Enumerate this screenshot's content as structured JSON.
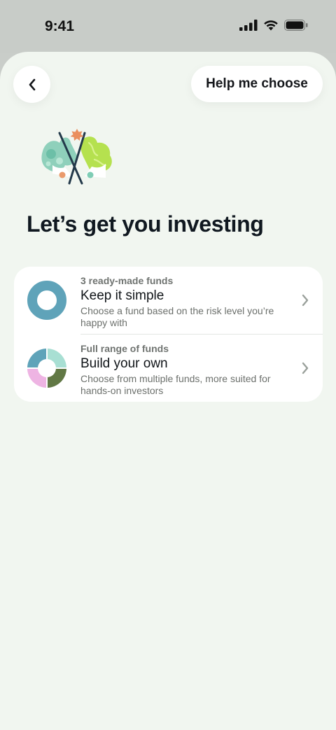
{
  "status_bar": {
    "time": "9:41",
    "icons": [
      "cellular-signal-icon",
      "wifi-icon",
      "battery-icon"
    ]
  },
  "header": {
    "back_icon": "chevron-left-icon",
    "help_label": "Help me choose"
  },
  "hero": {
    "illustration": "crossed-flags-illustration"
  },
  "page_title": "Let’s get you investing",
  "options": [
    {
      "eyebrow": "3 ready-made funds",
      "title": "Keep it simple",
      "description": "Choose a fund based on the risk level you’re happy with",
      "icon": "single-fund-ring-icon"
    },
    {
      "eyebrow": "Full range of funds",
      "title": "Build your own",
      "description": "Choose from multiple funds, more suited for hands-on investors",
      "icon": "multi-fund-ring-icon"
    }
  ],
  "colors": {
    "background": "#f1f6f0",
    "ring_blue": "#5fa3b9",
    "ring_mint": "#a8dfd3",
    "ring_pink": "#eeb4e3",
    "ring_olive": "#617845",
    "text_primary": "#101820",
    "text_secondary": "#6c706c"
  }
}
